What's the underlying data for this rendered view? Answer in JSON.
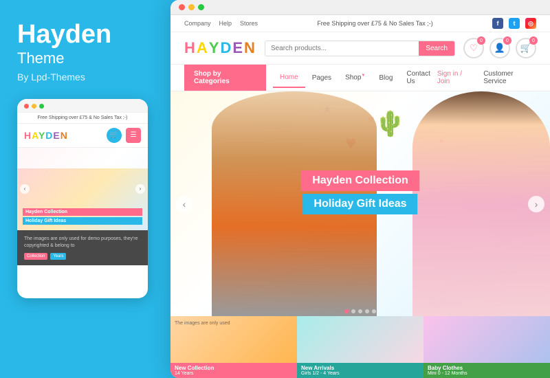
{
  "left": {
    "title": "Hayden",
    "subtitle": "Theme",
    "by": "By Lpd-Themes"
  },
  "mobile": {
    "shipping_text": "Free Shipping over £75 & No Sales Tax ;-)",
    "logo": "HAYDEN",
    "logo_letters": [
      "H",
      "A",
      "Y",
      "D",
      "E",
      "N"
    ],
    "banner_line1": "Hayden Collection",
    "banner_line2": "Holiday Gift Ideas",
    "bottom_text": "The images are only used for demo purposes, they're copyrighted & belong to",
    "cat1": "Collection",
    "cat2": "Years"
  },
  "desktop": {
    "top_links": [
      "Company",
      "Help",
      "Stores"
    ],
    "shipping_text": "Free Shipping over £75 & No Sales Tax ;-)",
    "logo_letters": [
      "H",
      "A",
      "Y",
      "D",
      "E",
      "N"
    ],
    "search_placeholder": "Search products...",
    "search_btn": "Search",
    "nav": {
      "categories_btn": "Shop by Categories",
      "links": [
        "Home",
        "Pages",
        "Shop",
        "Blog",
        "Contact Us"
      ],
      "sign_in": "Sign in / Join",
      "customer_service": "Customer Service"
    },
    "hero": {
      "badge1": "Hayden Collection",
      "badge2": "Holiday Gift Ideas"
    },
    "thumbs": [
      {
        "label": "New Collection",
        "sub": "14 Years",
        "label_class": "pink"
      },
      {
        "label": "New Arrivals",
        "sub": "Girls 1/2 - 4 Years",
        "label_class": "teal"
      },
      {
        "label": "Baby Clothes",
        "sub": "Mini 0 - 12 Months",
        "label_class": "green"
      }
    ],
    "slider_dots": [
      true,
      false,
      false,
      false,
      false
    ]
  }
}
